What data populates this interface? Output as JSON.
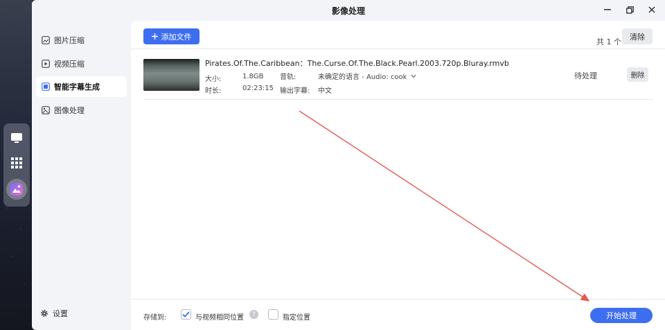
{
  "window": {
    "title": "影像处理",
    "controls": [
      "minimize-icon",
      "restore-icon",
      "close-icon"
    ]
  },
  "sidebar": {
    "items": [
      {
        "label": "图片压缩",
        "icon": "image-compress-icon",
        "active": false
      },
      {
        "label": "视频压缩",
        "icon": "video-compress-icon",
        "active": false
      },
      {
        "label": "智能字幕生成",
        "icon": "subtitle-icon",
        "active": true
      },
      {
        "label": "图像处理",
        "icon": "image-process-icon",
        "active": false
      }
    ],
    "settings_label": "设置"
  },
  "toolbar": {
    "add_label": "添加文件",
    "count_label": "共 1 个",
    "clear_label": "清除"
  },
  "files": [
    {
      "name": "Pirates.Of.The.Caribbean：The.Curse.Of.The.Black.Pearl.2003.720p.Bluray.rmvb",
      "size_label": "大小:",
      "size": "1.8GB",
      "duration_label": "时长:",
      "duration": "02:23:15",
      "audio_label": "音轨:",
      "audio": "未确定的语言 - Audio: cook",
      "subtitle_label": "输出字幕:",
      "subtitle": "中文",
      "status": "待处理",
      "delete_label": "删除"
    }
  ],
  "footer": {
    "save_to_label": "存储到:",
    "option_same": "与视频相同位置",
    "option_same_checked": true,
    "option_custom": "指定位置",
    "option_custom_checked": false,
    "start_label": "开始处理"
  },
  "colors": {
    "accent": "#3e6ef0",
    "annotation_arrow": "#e5574f"
  }
}
